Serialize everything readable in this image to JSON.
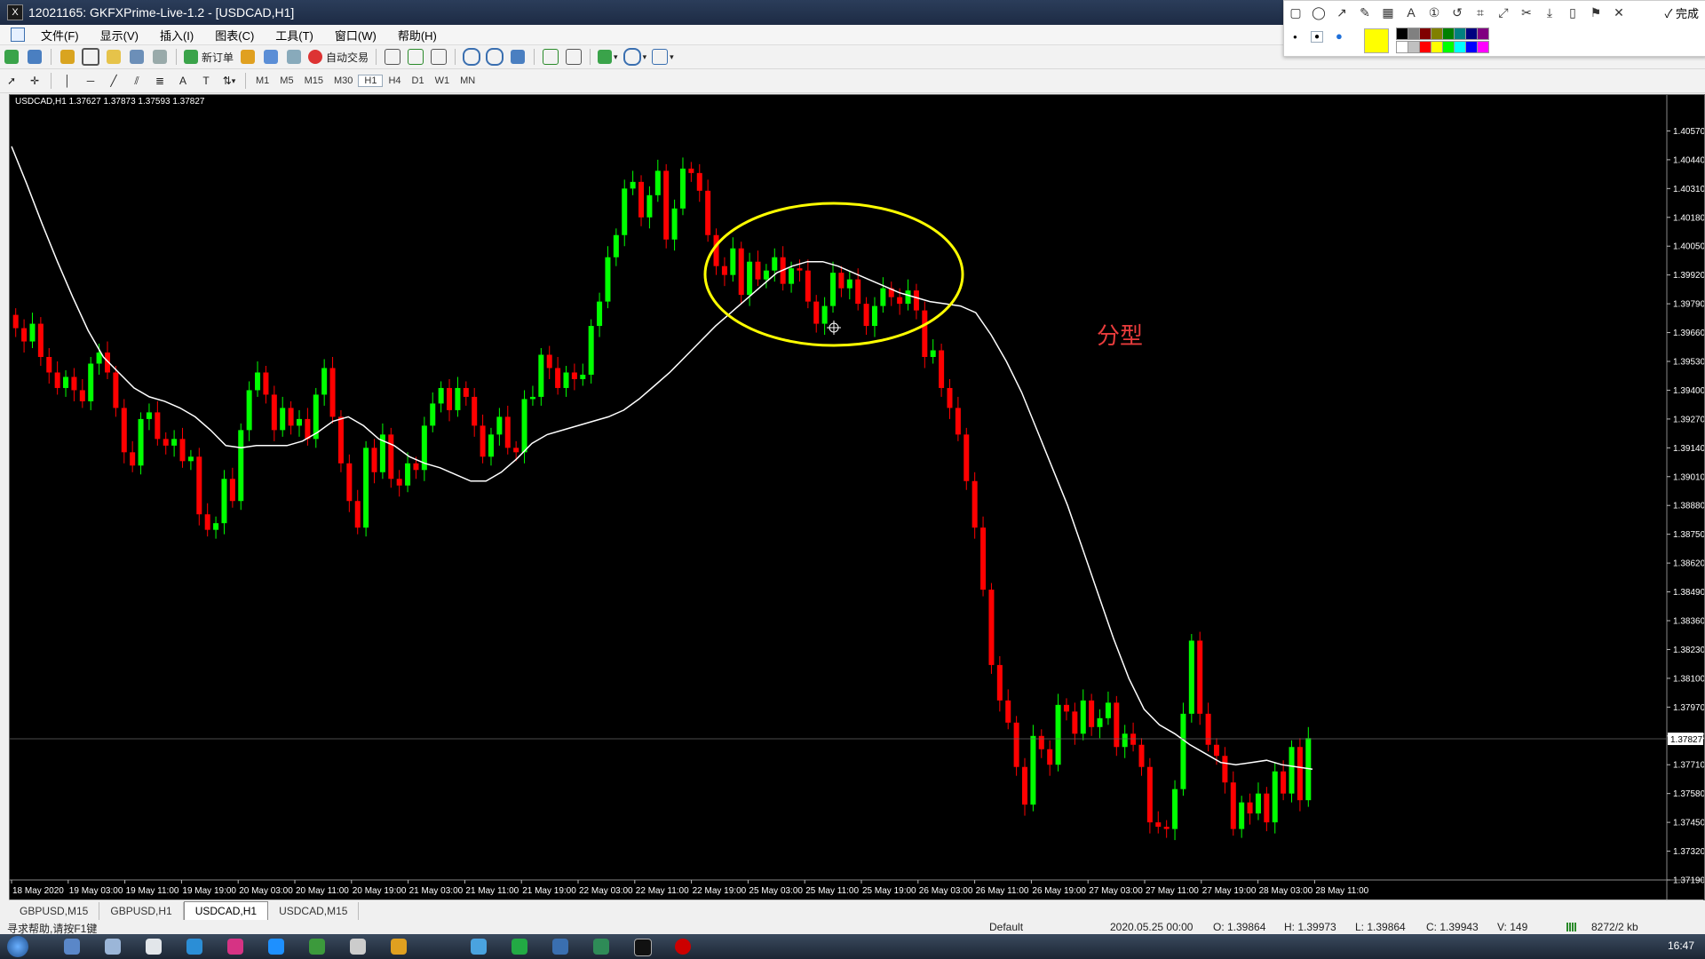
{
  "window": {
    "title": "12021165: GKFXPrime-Live-1.2 - [USDCAD,H1]",
    "app_icon": "X"
  },
  "menu": [
    "文件(F)",
    "显示(V)",
    "插入(I)",
    "图表(C)",
    "工具(T)",
    "窗口(W)",
    "帮助(H)"
  ],
  "toolbar": {
    "new_order": "新订单",
    "auto_trading": "自动交易"
  },
  "timeframes": [
    "M1",
    "M5",
    "M15",
    "M30",
    "H1",
    "H4",
    "D1",
    "W1",
    "MN"
  ],
  "active_timeframe": "H1",
  "annotation_toolbar": {
    "done_label": "完成",
    "current_color": "#ffff00",
    "colors": [
      "#000000",
      "#808080",
      "#800000",
      "#808000",
      "#008000",
      "#008080",
      "#000080",
      "#800080",
      "#ffffff",
      "#c0c0c0",
      "#ff0000",
      "#ffff00",
      "#00ff00",
      "#00ffff",
      "#0000ff",
      "#ff00ff"
    ]
  },
  "chart_info": "USDCAD,H1  1.37627 1.37873 1.37593 1.37827",
  "annotation_text": "分型",
  "chart_data": {
    "type": "candlestick",
    "symbol": "USDCAD",
    "timeframe": "H1",
    "y_ticks": [
      "1.40570",
      "1.40440",
      "1.40310",
      "1.40180",
      "1.40050",
      "1.39920",
      "1.39790",
      "1.39660",
      "1.39530",
      "1.39400",
      "1.39270",
      "1.39140",
      "1.39010",
      "1.38880",
      "1.38750",
      "1.38620",
      "1.38490",
      "1.38360",
      "1.38230",
      "1.38100",
      "1.37970",
      "1.37840",
      "1.37710",
      "1.37580",
      "1.37450",
      "1.37320",
      "1.37190"
    ],
    "ylim": [
      1.3719,
      1.407
    ],
    "current_price": "1.37827",
    "x_ticks": [
      "18 May 2020",
      "19 May 03:00",
      "19 May 11:00",
      "19 May 19:00",
      "20 May 03:00",
      "20 May 11:00",
      "20 May 19:00",
      "21 May 03:00",
      "21 May 11:00",
      "21 May 19:00",
      "22 May 03:00",
      "22 May 11:00",
      "22 May 19:00",
      "25 May 03:00",
      "25 May 11:00",
      "25 May 19:00",
      "26 May 03:00",
      "26 May 11:00",
      "26 May 19:00",
      "27 May 03:00",
      "27 May 11:00",
      "27 May 19:00",
      "28 May 03:00",
      "28 May 11:00"
    ],
    "up_color": "#00ff00",
    "down_color": "#ff0000",
    "ma_color": "#ffffff",
    "closes": [
      1.3968,
      1.3962,
      1.397,
      1.3955,
      1.3948,
      1.3941,
      1.3946,
      1.394,
      1.3935,
      1.3952,
      1.3957,
      1.3948,
      1.3932,
      1.3912,
      1.3906,
      1.3927,
      1.393,
      1.3918,
      1.3915,
      1.3918,
      1.3908,
      1.391,
      1.3884,
      1.3877,
      1.388,
      1.39,
      1.389,
      1.3922,
      1.394,
      1.3948,
      1.3938,
      1.3922,
      1.3932,
      1.3924,
      1.3927,
      1.3918,
      1.3938,
      1.395,
      1.3928,
      1.3907,
      1.389,
      1.3878,
      1.3914,
      1.3903,
      1.392,
      1.39,
      1.3897,
      1.3907,
      1.3904,
      1.3924,
      1.3934,
      1.3941,
      1.3931,
      1.3941,
      1.3937,
      1.3924,
      1.391,
      1.392,
      1.3928,
      1.3914,
      1.3912,
      1.3936,
      1.3937,
      1.3956,
      1.395,
      1.3941,
      1.3948,
      1.3945,
      1.3947,
      1.3969,
      1.398,
      1.4,
      1.401,
      1.4031,
      1.4034,
      1.4018,
      1.4028,
      1.4039,
      1.4008,
      1.4022,
      1.404,
      1.4038,
      1.403,
      1.401,
      1.3996,
      1.3992,
      1.4004,
      1.3983,
      1.3998,
      1.399,
      1.3994,
      1.4,
      1.3988,
      1.3995,
      1.3994,
      1.398,
      1.397,
      1.3978,
      1.3993,
      1.3986,
      1.399,
      1.3979,
      1.3969,
      1.3978,
      1.3986,
      1.3982,
      1.3979,
      1.3985,
      1.3976,
      1.3955,
      1.3958,
      1.3941,
      1.3932,
      1.392,
      1.3899,
      1.3878,
      1.385,
      1.3816,
      1.38,
      1.379,
      1.377,
      1.3753,
      1.3784,
      1.3778,
      1.3771,
      1.3798,
      1.3795,
      1.3785,
      1.38,
      1.3788,
      1.3792,
      1.3799,
      1.3779,
      1.3785,
      1.378,
      1.377,
      1.3745,
      1.3743,
      1.3742,
      1.376,
      1.3794,
      1.3827,
      1.3794,
      1.378,
      1.3775,
      1.3763,
      1.3742,
      1.3754,
      1.3749,
      1.3758,
      1.3745,
      1.3768,
      1.3758,
      1.3779,
      1.3755,
      1.3783
    ],
    "ma_values": [
      1.405,
      1.4033,
      1.4015,
      1.3998,
      1.3982,
      1.3967,
      1.3955,
      1.3948,
      1.3941,
      1.3937,
      1.3935,
      1.3932,
      1.3928,
      1.3922,
      1.3915,
      1.3914,
      1.3915,
      1.3915,
      1.3915,
      1.3917,
      1.3921,
      1.3926,
      1.3928,
      1.3924,
      1.3918,
      1.3915,
      1.391,
      1.3907,
      1.3905,
      1.3902,
      1.3899,
      1.3899,
      1.3903,
      1.3909,
      1.3916,
      1.392,
      1.3922,
      1.3924,
      1.3926,
      1.3928,
      1.3931,
      1.3936,
      1.3942,
      1.3948,
      1.3955,
      1.3962,
      1.3969,
      1.3975,
      1.3981,
      1.3987,
      1.3993,
      1.3996,
      1.3998,
      1.3998,
      1.3996,
      1.3993,
      1.399,
      1.3987,
      1.3984,
      1.3982,
      1.398,
      1.3979,
      1.3978,
      1.3975,
      1.3965,
      1.3953,
      1.3939,
      1.3922,
      1.3905,
      1.3888,
      1.3868,
      1.3848,
      1.3828,
      1.381,
      1.3796,
      1.3789,
      1.3785,
      1.378,
      1.3776,
      1.3772,
      1.3771,
      1.3772,
      1.3773,
      1.3771,
      1.377,
      1.3769
    ]
  },
  "tabs": [
    "GBPUSD,M15",
    "GBPUSD,H1",
    "USDCAD,H1",
    "USDCAD,M15"
  ],
  "active_tab": "USDCAD,H1",
  "status": {
    "help": "寻求帮助,请按F1键",
    "profile": "Default",
    "datetime": "2020.05.25 00:00",
    "open": "O: 1.39864",
    "high": "H: 1.39973",
    "low": "L: 1.39864",
    "close": "C: 1.39943",
    "volume": "V: 149",
    "traffic": "8272/2 kb"
  },
  "taskbar": {
    "time": "16:47"
  }
}
